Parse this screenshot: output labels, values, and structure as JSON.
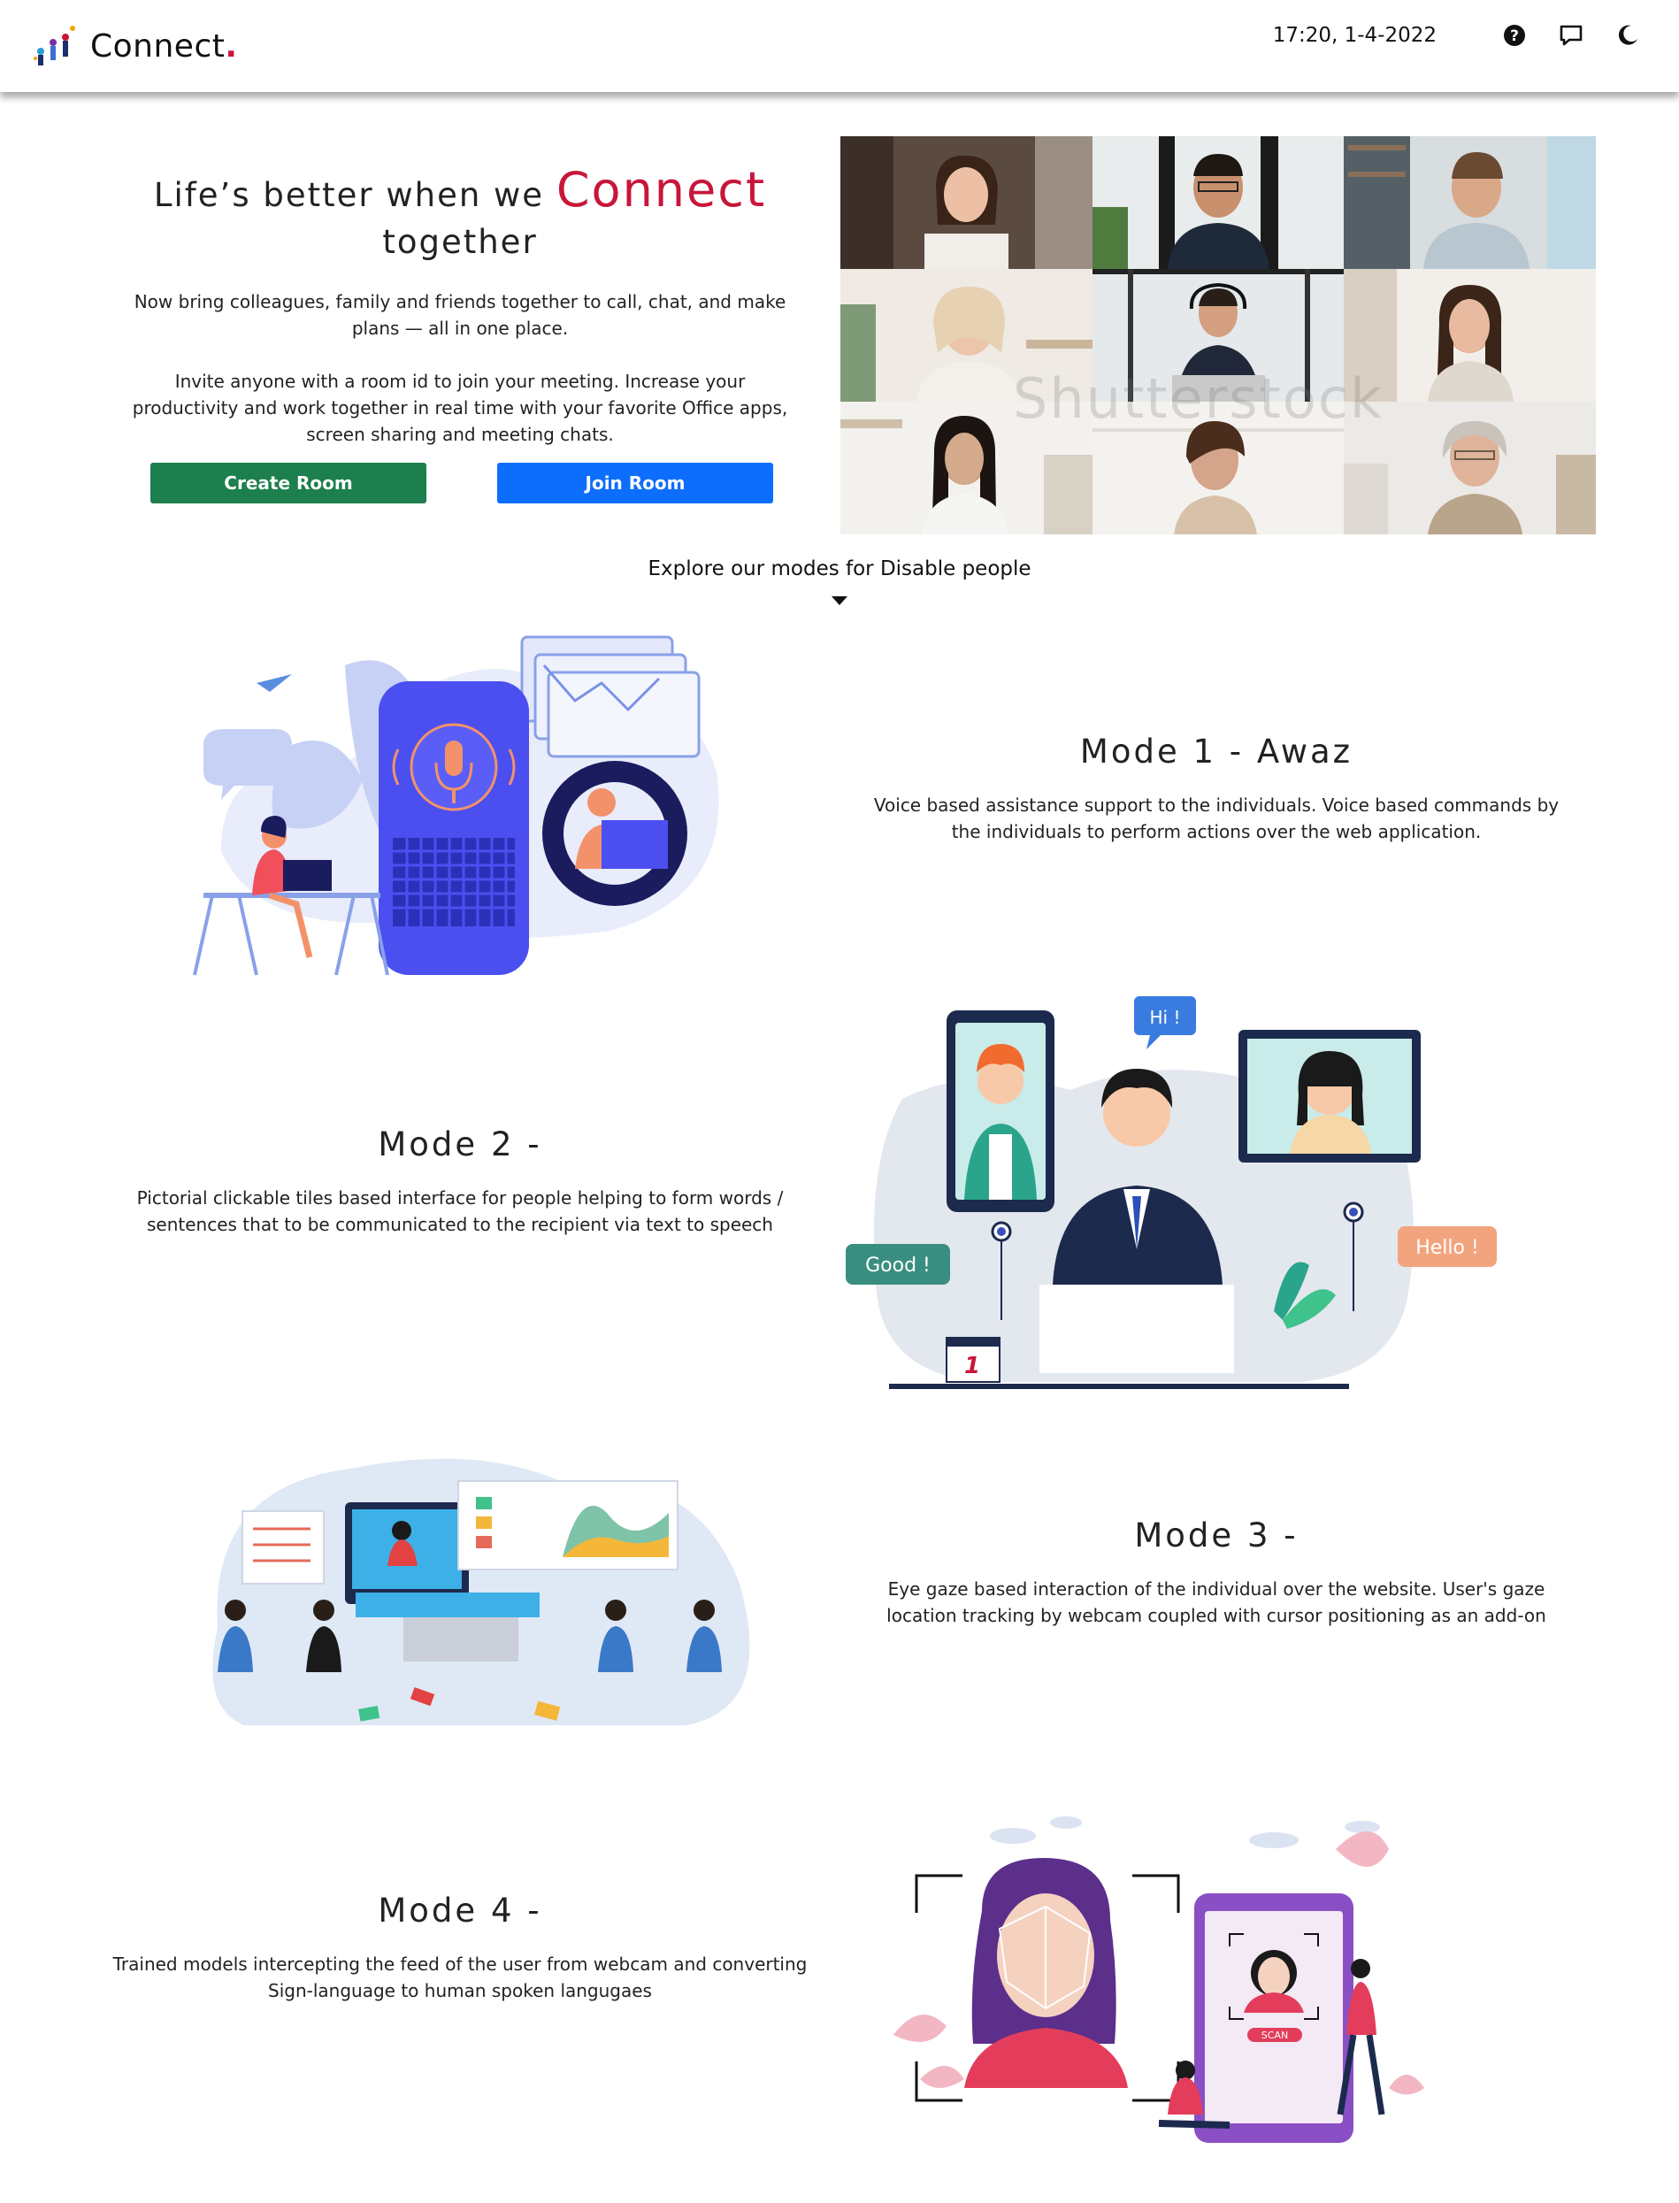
{
  "header": {
    "brand": "Connect",
    "brand_dot": ".",
    "datetime": "17:20, 1-4-2022",
    "icons": [
      "help-icon",
      "chat-icon",
      "dark-mode-icon"
    ]
  },
  "hero": {
    "title_part1": "Life’s better when we",
    "title_brand": "Connect",
    "title_part2": "together",
    "paragraph1": "Now bring colleagues, family and friends together to call, chat, and make plans — all in one place.",
    "paragraph2": "Invite anyone with a room id to join your meeting. Increase your productivity and work together in real time with your favorite Office apps, screen sharing and meeting chats.",
    "create_button": "Create Room",
    "join_button": "Join Room",
    "watermark": "Shutterstock"
  },
  "explore": {
    "label": "Explore our modes for Disable people"
  },
  "modes": [
    {
      "title": "Mode 1 - Awaz",
      "description": "Voice based assistance support to the individuals. Voice based commands by the individuals to perform actions over the web application."
    },
    {
      "title": "Mode 2 -",
      "description": "Pictorial clickable tiles based interface for people helping to form words / sentences that to be communicated to the recipient via text to speech"
    },
    {
      "title": "Mode 3 -",
      "description": "Eye gaze based interaction of the individual over the website. User's gaze location tracking by webcam coupled with cursor positioning as an add-on"
    },
    {
      "title": "Mode 4 -",
      "description": "Trained models intercepting the feed of the user from webcam and converting Sign-language to human spoken langugaes"
    }
  ],
  "illustration_text": {
    "hi": "Hi !",
    "good": "Good !",
    "hello": "Hello !",
    "calendar": "1",
    "scan": "SCAN"
  },
  "colors": {
    "brand": "#c8163a",
    "create": "#1c7f4d",
    "join": "#0d6efd"
  }
}
